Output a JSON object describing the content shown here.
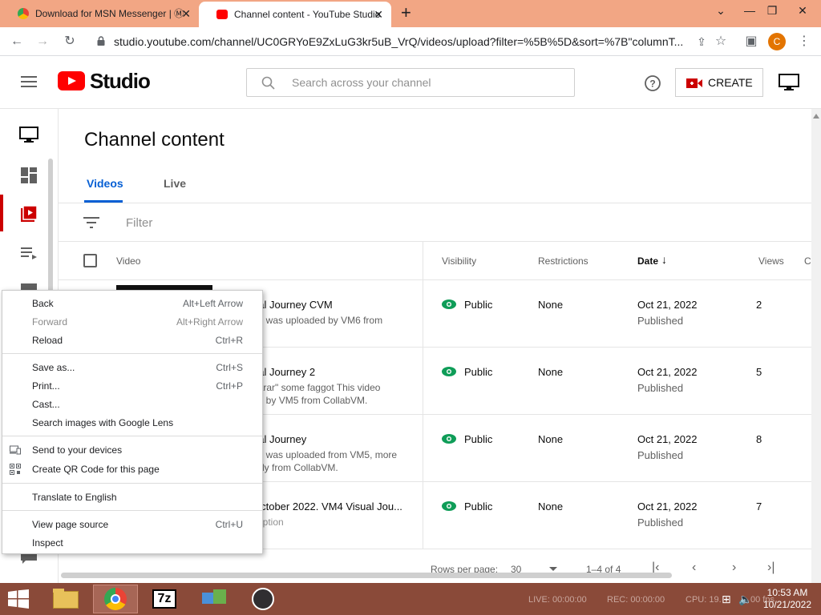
{
  "browser": {
    "tabs": [
      {
        "title": "Download for MSN Messenger | Ⓜ",
        "active": false
      },
      {
        "title": "Channel content - YouTube Studio",
        "active": true
      }
    ],
    "new_tab": "+",
    "url": "studio.youtube.com/channel/UC0GRYoE9ZxLuG3kr5uB_VrQ/videos/upload?filter=%5B%5D&sort=%7B\"columnT...",
    "profile_initial": "C"
  },
  "studio": {
    "logo_text": "Studio",
    "search_placeholder": "Search across your channel",
    "create_label": "CREATE"
  },
  "content": {
    "title": "Channel content",
    "tabs": [
      "Videos",
      "Live"
    ],
    "filter_placeholder": "Filter",
    "columns": {
      "video": "Video",
      "visibility": "Visibility",
      "restrictions": "Restrictions",
      "date": "Date",
      "views": "Views",
      "comments": "C"
    },
    "rows": [
      {
        "title": "ual Journey CVM",
        "desc": "eo was uploaded by VM6 from\nM",
        "visibility": "Public",
        "restrictions": "None",
        "date": "Oct 21, 2022",
        "status": "Published",
        "views": "2"
      },
      {
        "title": "ual Journey 2",
        "desc": "earar\" some faggot This video\nde by VM5 from CollabVM.",
        "visibility": "Public",
        "restrictions": "None",
        "date": "Oct 21, 2022",
        "status": "Published",
        "views": "5"
      },
      {
        "title": "ual Journey",
        "desc": "eo was uploaded from VM5, more\nially from CollabVM.",
        "visibility": "Public",
        "restrictions": "None",
        "date": "Oct 21, 2022",
        "status": "Published",
        "views": "8"
      },
      {
        "title": "October 2022. VM4 Visual Jou...",
        "desc": "cription",
        "visibility": "Public",
        "restrictions": "None",
        "date": "Oct 21, 2022",
        "status": "Published",
        "views": "7"
      }
    ],
    "pager": {
      "rows_label": "Rows per page:",
      "rows_value": "30",
      "range": "1–4 of 4"
    }
  },
  "context_menu": {
    "items": [
      {
        "label": "Back",
        "shortcut": "Alt+Left Arrow",
        "disabled": false
      },
      {
        "label": "Forward",
        "shortcut": "Alt+Right Arrow",
        "disabled": true
      },
      {
        "label": "Reload",
        "shortcut": "Ctrl+R",
        "disabled": false
      },
      {
        "label": "Save as...",
        "shortcut": "Ctrl+S",
        "disabled": false
      },
      {
        "label": "Print...",
        "shortcut": "Ctrl+P",
        "disabled": false
      },
      {
        "label": "Cast...",
        "shortcut": "",
        "disabled": false
      },
      {
        "label": "Search images with Google Lens",
        "shortcut": "",
        "disabled": false
      },
      {
        "label": "Send to your devices",
        "shortcut": "",
        "disabled": false,
        "icon": "devices-icon"
      },
      {
        "label": "Create QR Code for this page",
        "shortcut": "",
        "disabled": false,
        "icon": "qr-code-icon"
      },
      {
        "label": "Translate to English",
        "shortcut": "",
        "disabled": false
      },
      {
        "label": "View page source",
        "shortcut": "Ctrl+U",
        "disabled": false
      },
      {
        "label": "Inspect",
        "shortcut": "",
        "disabled": false
      }
    ]
  },
  "taskbar": {
    "live": "LIVE: 00:00:00",
    "rec": "REC: 00:00:00",
    "cpu": "CPU: 19.",
    "fps": "00 fps",
    "time": "10:53 AM",
    "date": "10/21/2022"
  },
  "colors": {
    "youtube_red": "#ff0000",
    "accent_blue": "#065fd4",
    "public_green": "#0f9d58",
    "tab_strip": "#f2a684",
    "taskbar": "#8a4a39"
  }
}
